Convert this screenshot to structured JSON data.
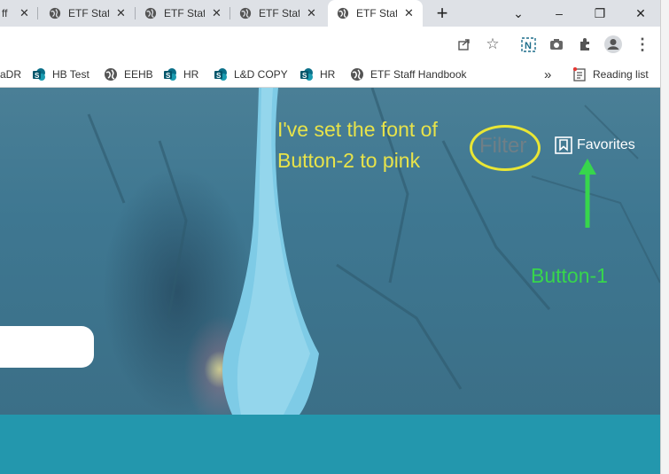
{
  "tabs": [
    {
      "title": "ETF Staff Handbook",
      "active": false
    },
    {
      "title": "ETF Staff Handbook",
      "active": false
    },
    {
      "title": "ETF Staff Handbook",
      "active": false
    },
    {
      "title": "ETF Staff Handbook",
      "active": false
    },
    {
      "title": "ETF Staff Handbook",
      "active": true
    }
  ],
  "first_tab_partial": "ff",
  "new_tab_label": "+",
  "window_controls": {
    "dropdown": "⌄",
    "minimize": "–",
    "restore": "❐",
    "close": "✕"
  },
  "bookmarks": [
    {
      "label": "aDR",
      "icon": "none"
    },
    {
      "label": "HB Test",
      "icon": "sharepoint-icon"
    },
    {
      "label": "EEHB",
      "icon": "globe-icon"
    },
    {
      "label": "HR",
      "icon": "sharepoint-icon"
    },
    {
      "label": "L&D COPY",
      "icon": "sharepoint-icon"
    },
    {
      "label": "HR",
      "icon": "sharepoint-icon"
    },
    {
      "label": "ETF Staff Handbook",
      "icon": "globe-icon"
    }
  ],
  "bookmarks_overflow": "»",
  "reading_list": "Reading list",
  "page": {
    "filter_label": "Filter",
    "favorites_label": "Favorites",
    "annotation_text": "I've set the font of Button-2 to pink",
    "button1_label": "Button-1"
  },
  "colors": {
    "annotation_yellow": "#e8e34a",
    "annotation_green": "#37d64c",
    "band": "#2397ad"
  }
}
